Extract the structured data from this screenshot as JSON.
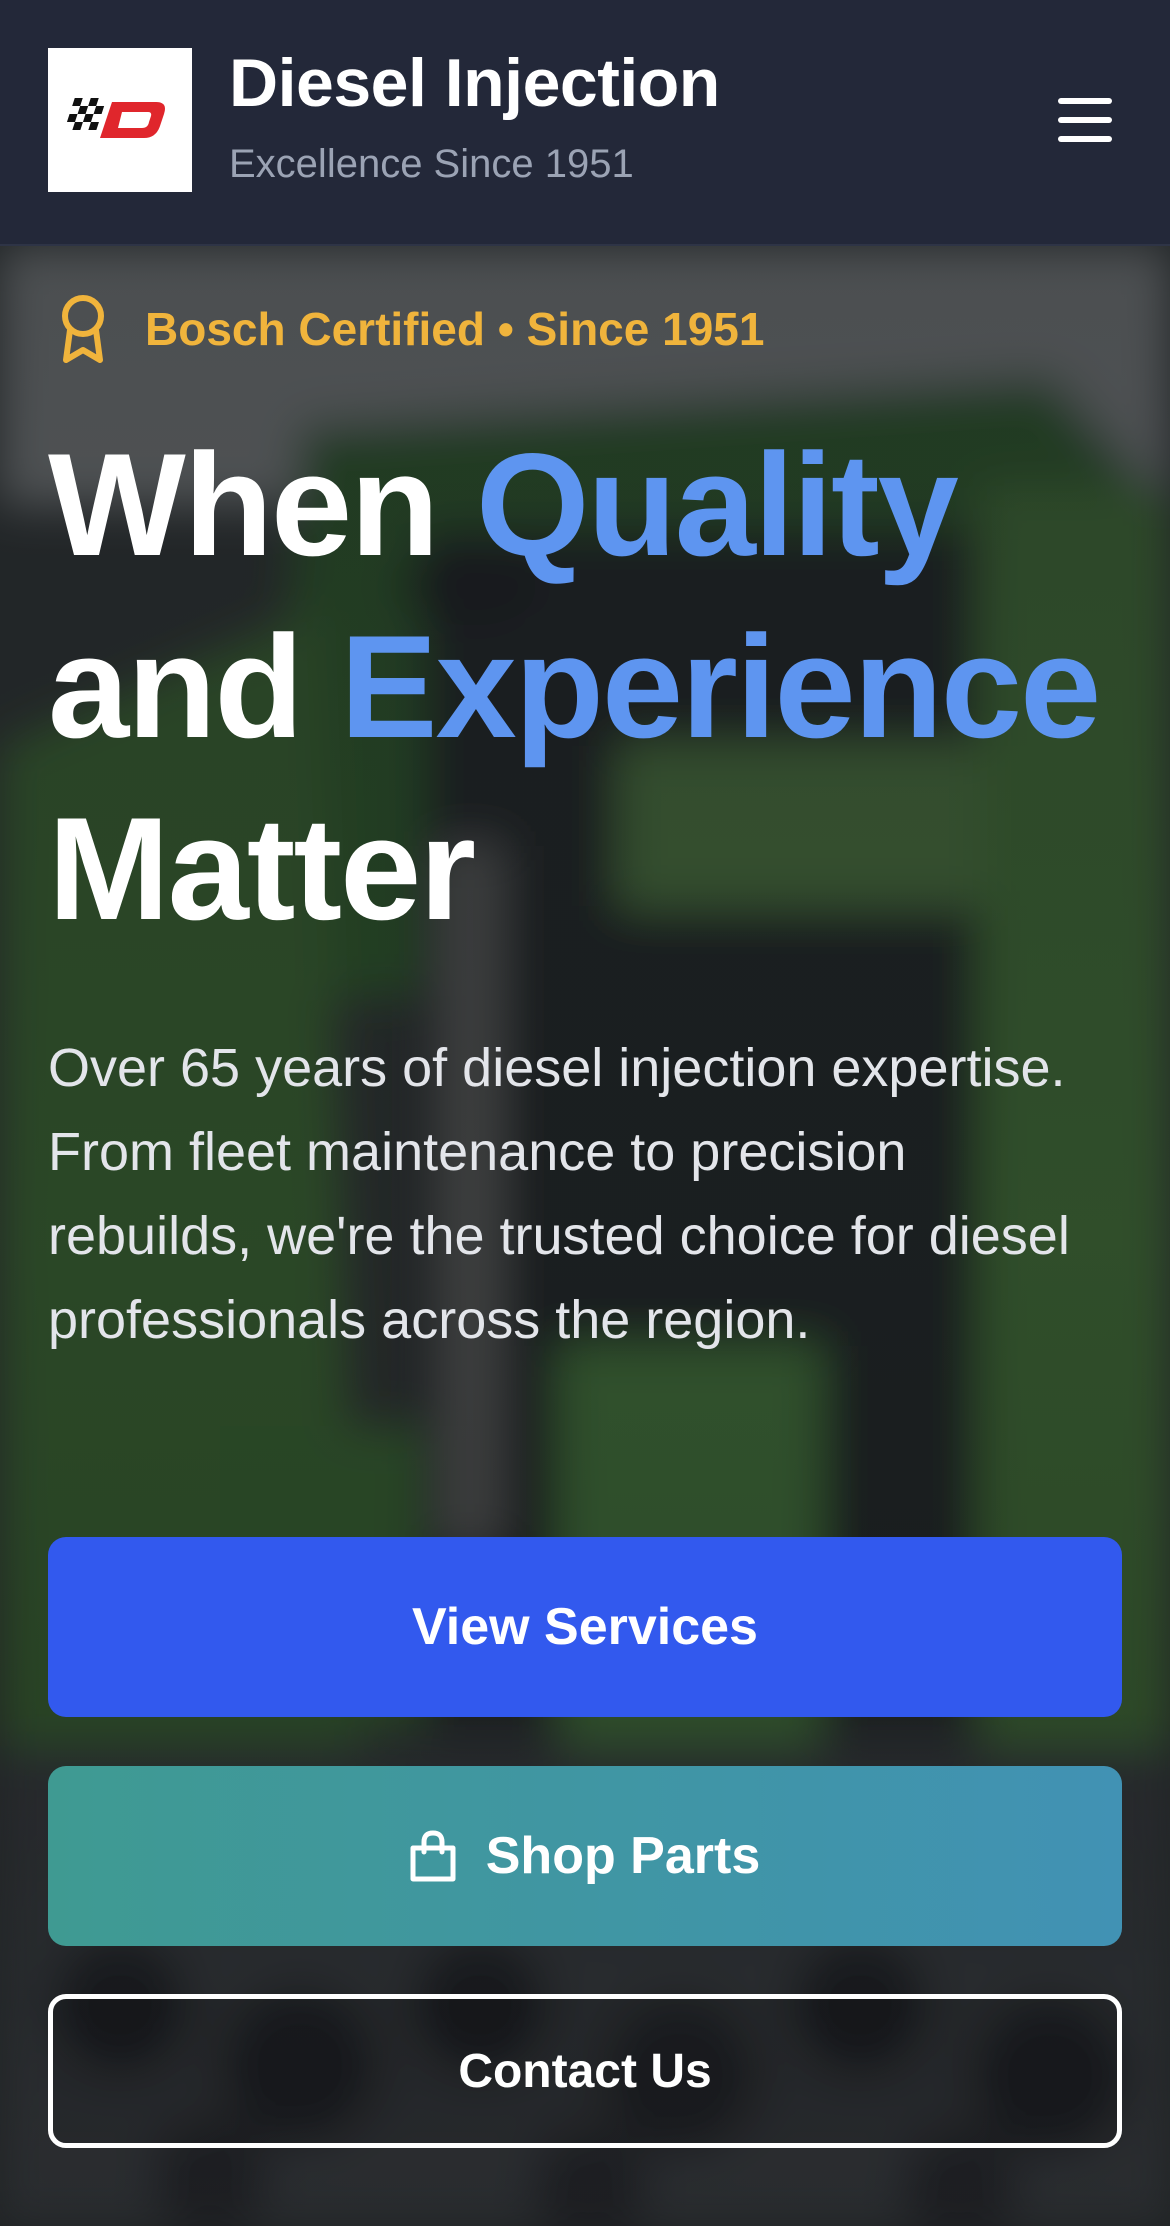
{
  "header": {
    "brand_title": "Diesel Injection",
    "brand_tagline": "Excellence Since 1951",
    "logo_icon": "checkered-flag-d-logo",
    "menu_icon": "hamburger-menu-icon"
  },
  "hero": {
    "badge_icon": "award-ribbon-icon",
    "badge_text": "Bosch Certified • Since 1951",
    "headline": {
      "line1_plain": "When ",
      "line1_accent": "Quality",
      "line2_plain": "and ",
      "line2_accent": "Experience",
      "line3_plain": "Matter"
    },
    "intro": "Over 65 years of diesel injection expertise. From fleet maintenance to precision rebuilds, we're the trusted choice for diesel professionals across the region.",
    "buttons": {
      "view_services": "View Services",
      "shop_parts": "Shop Parts",
      "contact_us": "Contact Us"
    },
    "shop_icon": "shopping-bag-icon"
  },
  "colors": {
    "header_bg": "#232839",
    "badge_gold": "#f0b43c",
    "headline_accent": "#5e95f0",
    "primary_button": "#3259ee",
    "shop_button_start": "#3f9a92",
    "shop_button_end": "#4192b4"
  }
}
